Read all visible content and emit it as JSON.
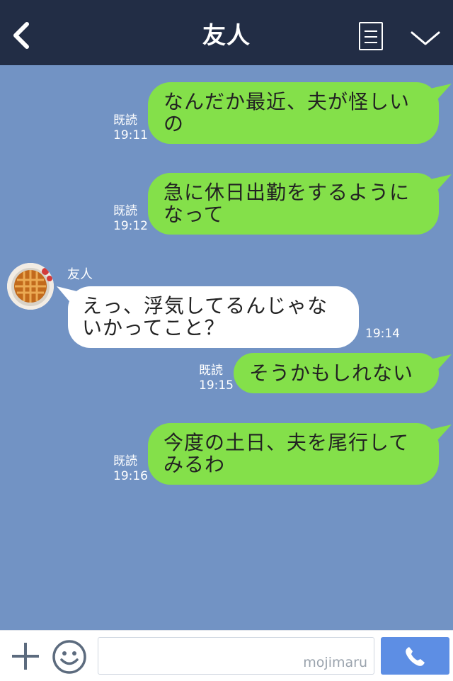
{
  "header": {
    "title": "友人"
  },
  "messages": [
    {
      "text": "なんだか最近、夫が怪しいの",
      "read": "既読",
      "time": "19:11"
    },
    {
      "text": "急に休日出勤をするようになって",
      "read": "既読",
      "time": "19:12"
    },
    {
      "sender": "友人",
      "text": "えっ、浮気してるんじゃないかってこと？",
      "time": "19:14"
    },
    {
      "text": "そうかもしれない",
      "read": "既読",
      "time": "19:15"
    },
    {
      "text": "今度の土日、夫を尾行してみるわ",
      "read": "既読",
      "time": "19:16"
    }
  ],
  "footer": {
    "watermark": "mojimaru"
  },
  "colors": {
    "header": "#222d45",
    "chat_bg": "#7293c4",
    "outgoing": "#84e04a",
    "incoming": "#ffffff",
    "call": "#5d8ee4"
  },
  "icons": [
    "back-chevron-icon",
    "menu-list-icon",
    "chevron-down-icon",
    "plus-icon",
    "emoji-icon",
    "phone-icon"
  ]
}
